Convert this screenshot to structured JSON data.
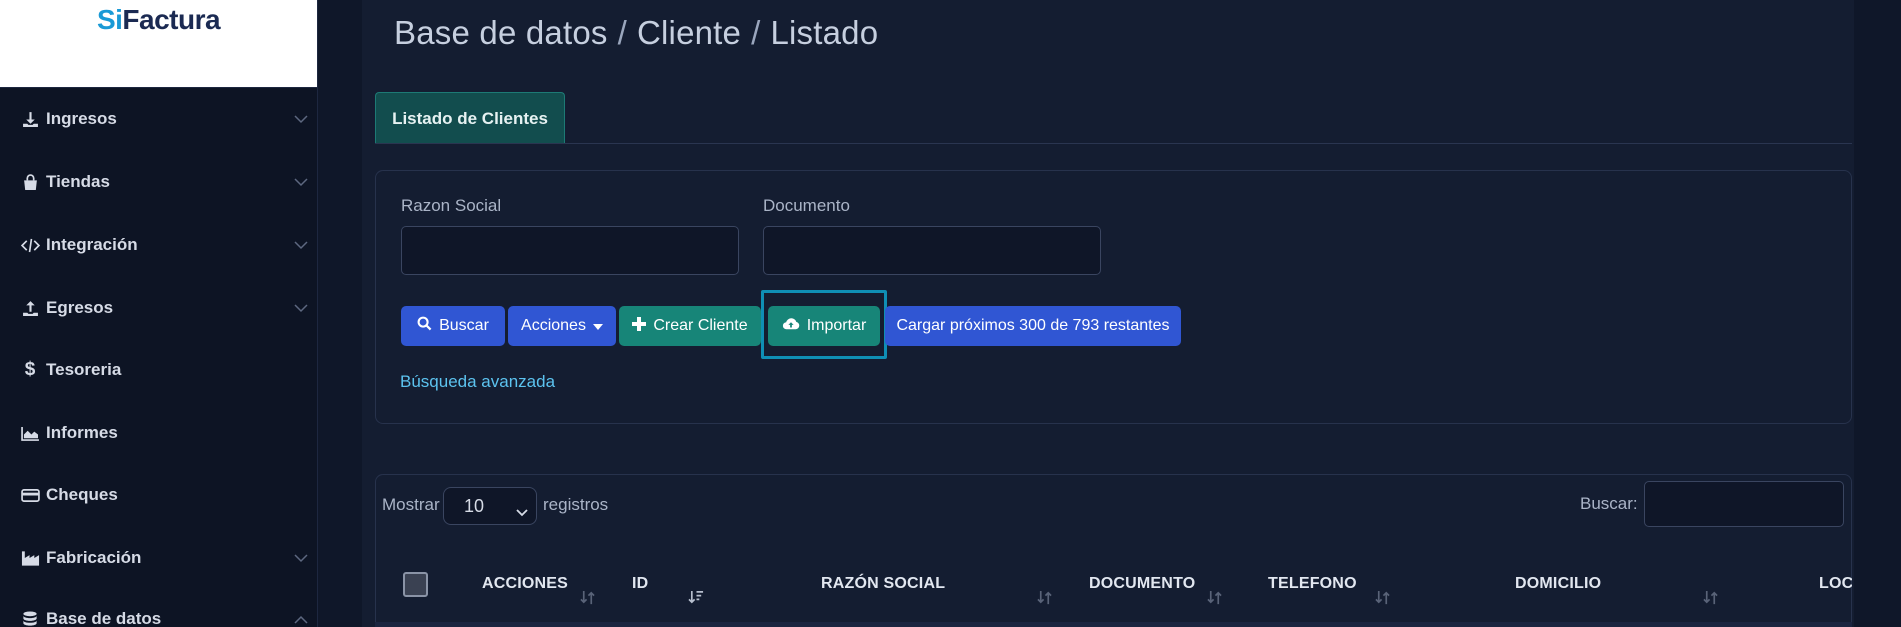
{
  "logo": {
    "brand_a": "Si",
    "brand_b": "Factura"
  },
  "sidebar": {
    "items": [
      {
        "label": "Ingresos",
        "icon": "download-icon",
        "chevron": "chevron-down-icon"
      },
      {
        "label": "Tiendas",
        "icon": "shopping-bag-icon",
        "chevron": "chevron-down-icon"
      },
      {
        "label": "Integración",
        "icon": "code-icon",
        "chevron": "chevron-down-icon"
      },
      {
        "label": "Egresos",
        "icon": "upload-icon",
        "chevron": "chevron-down-icon"
      },
      {
        "label": "Tesoreria",
        "icon": "dollar-icon",
        "chevron": null
      },
      {
        "label": "Informes",
        "icon": "area-chart-icon",
        "chevron": null
      },
      {
        "label": "Cheques",
        "icon": "credit-card-icon",
        "chevron": null
      },
      {
        "label": "Fabricación",
        "icon": "industry-icon",
        "chevron": "chevron-down-icon"
      },
      {
        "label": "Base de datos",
        "icon": "database-icon",
        "chevron": "chevron-up-icon"
      }
    ]
  },
  "breadcrumb": {
    "part1": "Base de datos",
    "part2": "Cliente",
    "part3": "Listado",
    "sep": "/"
  },
  "tab": {
    "label": "Listado de Clientes"
  },
  "filters": {
    "razon_social_label": "Razon Social",
    "razon_social_value": "",
    "documento_label": "Documento",
    "documento_value": ""
  },
  "buttons": {
    "buscar": "Buscar",
    "acciones": "Acciones",
    "crear": "Crear Cliente",
    "importar": "Importar",
    "cargar": "Cargar próximos 300 de 793 restantes"
  },
  "advanced_search": "Búsqueda avanzada",
  "table_controls": {
    "mostrar": "Mostrar",
    "page_size": "10",
    "registros": "registros",
    "buscar": "Buscar:"
  },
  "table": {
    "columns": [
      "ACCIONES",
      "ID",
      "RAZÓN SOCIAL",
      "DOCUMENTO",
      "TELEFONO",
      "DOMICILIO",
      "LOC"
    ]
  },
  "colors": {
    "accent_blue": "#3056d3",
    "accent_green": "#178578",
    "highlight": "#0f8fb5",
    "link": "#5cc3ef"
  }
}
